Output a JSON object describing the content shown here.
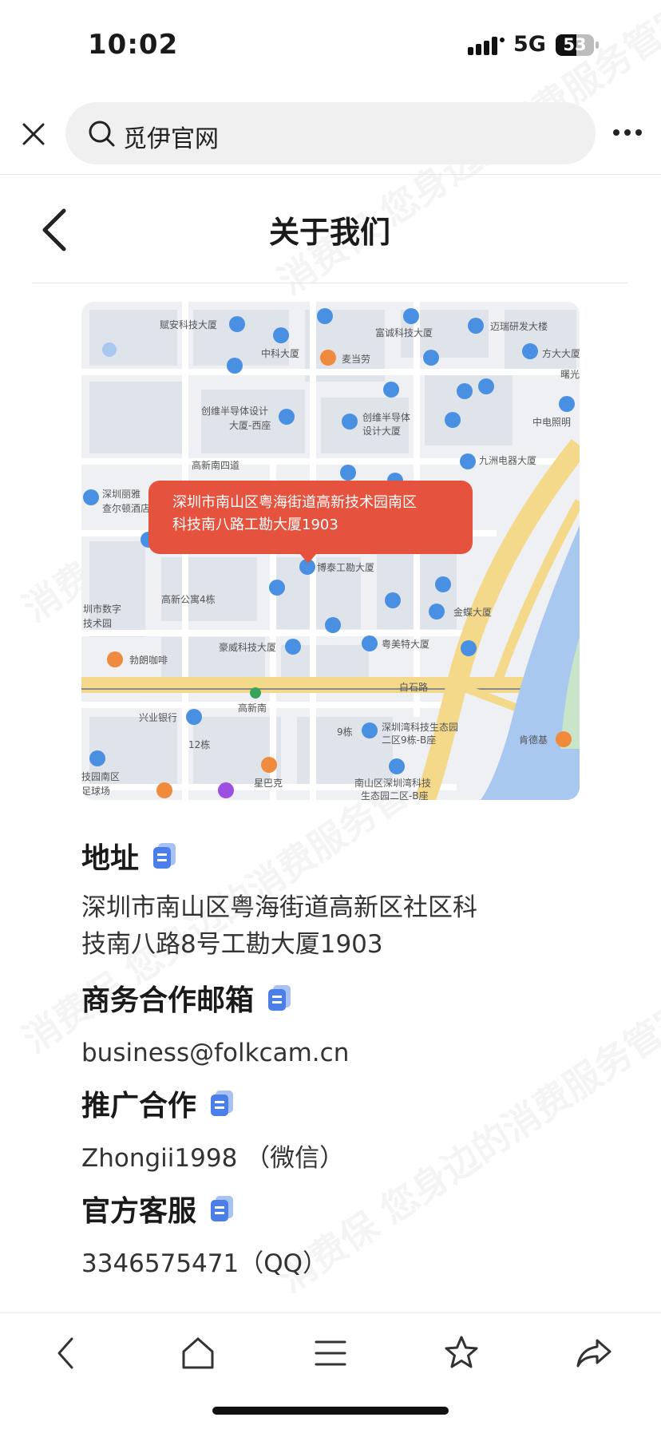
{
  "status": {
    "time": "10:02",
    "network": "5G",
    "battery": "53"
  },
  "search": {
    "query": "觅伊官网"
  },
  "header": {
    "title": "关于我们"
  },
  "map": {
    "bubble_line1": "深圳市南山区粤海街道高新技术园南区",
    "bubble_line2": "科技南八路工勘大厦1903",
    "labels": {
      "l1": "赋安科技大厦",
      "l2": "中科大厦",
      "l3": "麦当劳",
      "l4": "富诚科技大厦",
      "l5": "迈瑞研发大楼",
      "l6": "方大大厦",
      "l7": "曙光",
      "l8": "创维半导体设计",
      "l9": "大厦-西座",
      "l10": "创维半导体",
      "l11": "设计大厦",
      "l12": "中电照明",
      "l13": "九洲电器大厦",
      "l14": "高新南四道",
      "l15": "深圳丽雅",
      "l16": "查尔顿酒店",
      "l17": "博泰工勘大厦",
      "l18": "高新公寓4栋",
      "l19": "圳市数字",
      "l20": "技术园",
      "l21": "金蝶大厦",
      "l22": "豪威科技大厦",
      "l23": "粤美特大厦",
      "l24": "勃朗咖啡",
      "l25": "白石路",
      "l26": "高新南",
      "l27": "兴业银行",
      "l28": "深圳湾科技生态园",
      "l29": "二区9栋-B座",
      "l30": "肯德基",
      "l31": "12栋",
      "l32": "9栋",
      "l33": "技园南区",
      "l34": "足球场",
      "l35": "星巴克",
      "l36": "南山区深圳湾科技",
      "l37": "生态园二区-B座"
    }
  },
  "info": {
    "address": {
      "heading": "地址",
      "line1": "深圳市南山区粤海街道高新区社区科",
      "line2": "技南八路8号工勘大厦1903"
    },
    "email": {
      "heading": "商务合作邮箱",
      "value": "business@folkcam.cn"
    },
    "promo": {
      "heading": "推广合作",
      "value": "Zhongii1998 （微信）"
    },
    "service": {
      "heading": "官方客服",
      "value": "3346575471（QQ）"
    }
  },
  "watermark": {
    "text": "消费保 您身边的消费服务管家"
  },
  "colors": {
    "accent": "#e5533f",
    "copy_icon": "#4a7ee8",
    "road_major": "#f5d98b",
    "water": "#a8c8f0"
  },
  "icons": [
    "close-icon",
    "search-icon",
    "more-icon",
    "back-icon",
    "copy-icon",
    "nav-back-icon",
    "home-icon",
    "menu-icon",
    "star-icon",
    "share-icon"
  ]
}
